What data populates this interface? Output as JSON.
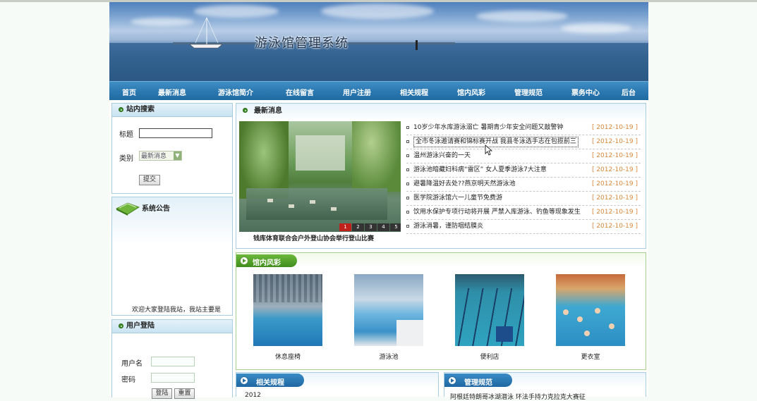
{
  "site": {
    "title": "游泳馆管理系统"
  },
  "nav": [
    "首页",
    "最新消息",
    "游泳馆简介",
    "在线留言",
    "用户注册",
    "相关规程",
    "馆内风彩",
    "管理规范",
    "票务中心",
    "后台"
  ],
  "search": {
    "title": "站内搜索",
    "title_label": "标题",
    "category_label": "类别",
    "category_value": "最新消息",
    "submit_label": "提交"
  },
  "notice": {
    "title": "系统公告",
    "text": "欢迎大家登陆我站，我站主要是"
  },
  "login": {
    "title": "用户登陆",
    "username_label": "用户名",
    "password_label": "密码",
    "login_label": "登陆",
    "reset_label": "重置"
  },
  "news": {
    "title": "最新消息",
    "slide_caption": "钱库体育联合会户外登山协会举行登山比赛",
    "slide_pages": [
      "1",
      "2",
      "3",
      "4",
      "5"
    ],
    "items": [
      {
        "title": "10岁少年水库游泳溺亡 暑期青少年安全问题又敲警钟",
        "date": "[ 2012-10-19 ]"
      },
      {
        "title": "全市冬泳邀请赛和锦标赛开战 我县冬泳选手志在包揽前三",
        "date": "[ 2012-10-19 ]"
      },
      {
        "title": "温州游泳兴奋的一天",
        "date": "[ 2012-10-19 ]"
      },
      {
        "title": "游泳池暗藏妇科病“雷区” 女人夏季游泳7大注意",
        "date": "[ 2012-10-19 ]"
      },
      {
        "title": "避暑降温好去处??燕京明天然游泳池",
        "date": "[ 2012-10-19 ]"
      },
      {
        "title": "医学院游泳馆六一儿童节免费游",
        "date": "[ 2012-10-19 ]"
      },
      {
        "title": "饮用水保护专项行动将开展 严禁入库游泳、钓鱼等现象发生",
        "date": "[ 2012-10-19 ]"
      },
      {
        "title": "游泳消暑，谨防咽结膜炎",
        "date": "[ 2012-10-19 ]"
      }
    ]
  },
  "gallery": {
    "title": "馆内风彩",
    "items": [
      "休息座椅",
      "游泳池",
      "便利店",
      "更衣室"
    ]
  },
  "rules": {
    "title": "相关规程",
    "first_item": "2012"
  },
  "manage": {
    "title": "管理规范",
    "first_item": "阿根廷特朗哥冰湖潜泳 环法手持力克拉克大赛征"
  }
}
